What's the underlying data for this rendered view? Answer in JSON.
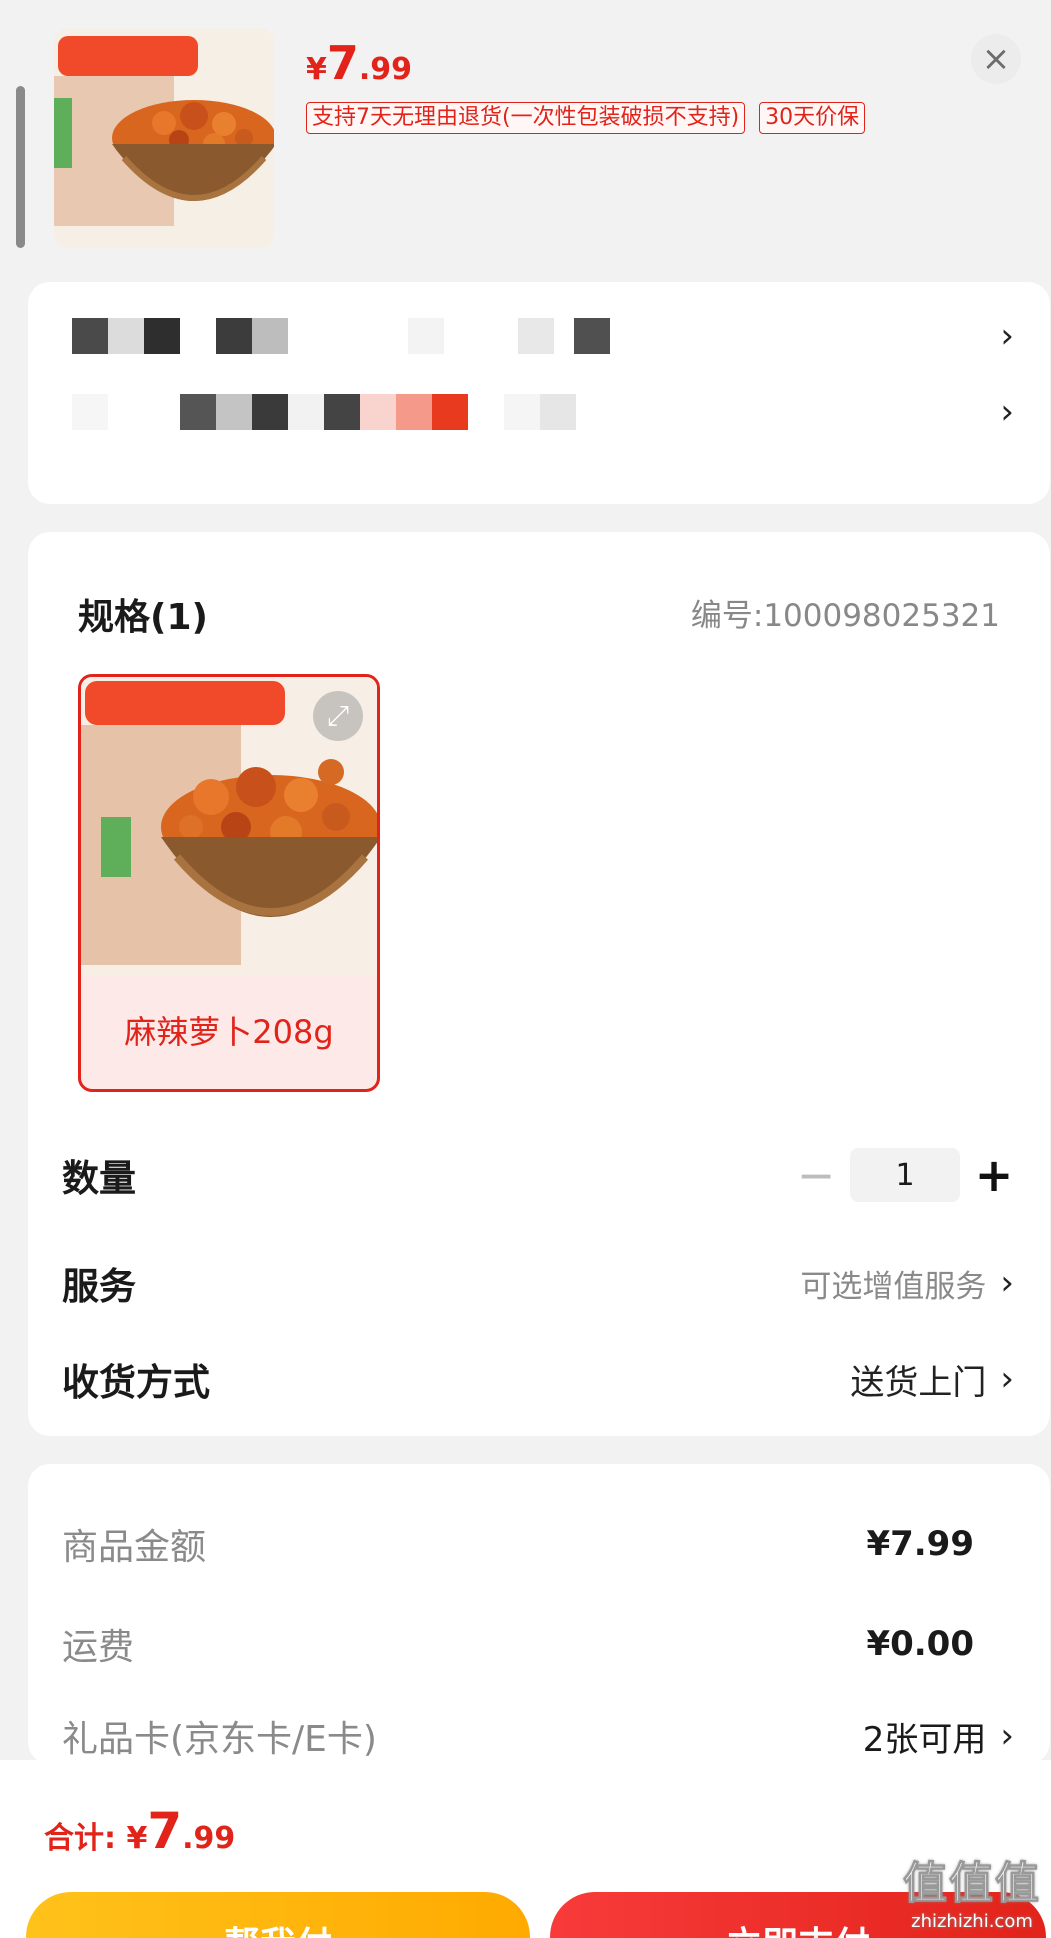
{
  "header": {
    "price_currency": "¥",
    "price_int": "7",
    "price_dec": ".99",
    "tags": [
      "支持7天无理由退货(一次性包装破损不支持)",
      "30天价保"
    ],
    "close_label": "×"
  },
  "address": {
    "chevron": "›"
  },
  "spec": {
    "title": "规格(1)",
    "code": "编号:100098025321",
    "option_label": "麻辣萝卜208g",
    "expand_glyph": "⤢"
  },
  "quantity": {
    "label": "数量",
    "minus": "−",
    "value": "1",
    "plus": "+"
  },
  "service": {
    "label": "服务",
    "value": "可选增值服务",
    "chevron": "›"
  },
  "delivery": {
    "label": "收货方式",
    "value": "送货上门",
    "chevron": "›"
  },
  "summary": {
    "goods_label": "商品金额",
    "goods_value": "¥7.99",
    "shipping_label": "运费",
    "shipping_value": "¥0.00",
    "giftcard_label": "礼品卡(京东卡/E卡)",
    "giftcard_value": "2张可用",
    "chevron": "›"
  },
  "footer": {
    "total_label": "合计: ",
    "total_currency": "¥",
    "total_int": "7",
    "total_dec": ".99",
    "help_pay": "帮我付",
    "pay": "立即支付"
  },
  "watermark": {
    "main": "值值值",
    "sub": "zhizhizhi.com"
  },
  "colors": {
    "accent": "#e2231a",
    "help_button": "#ffb400"
  }
}
